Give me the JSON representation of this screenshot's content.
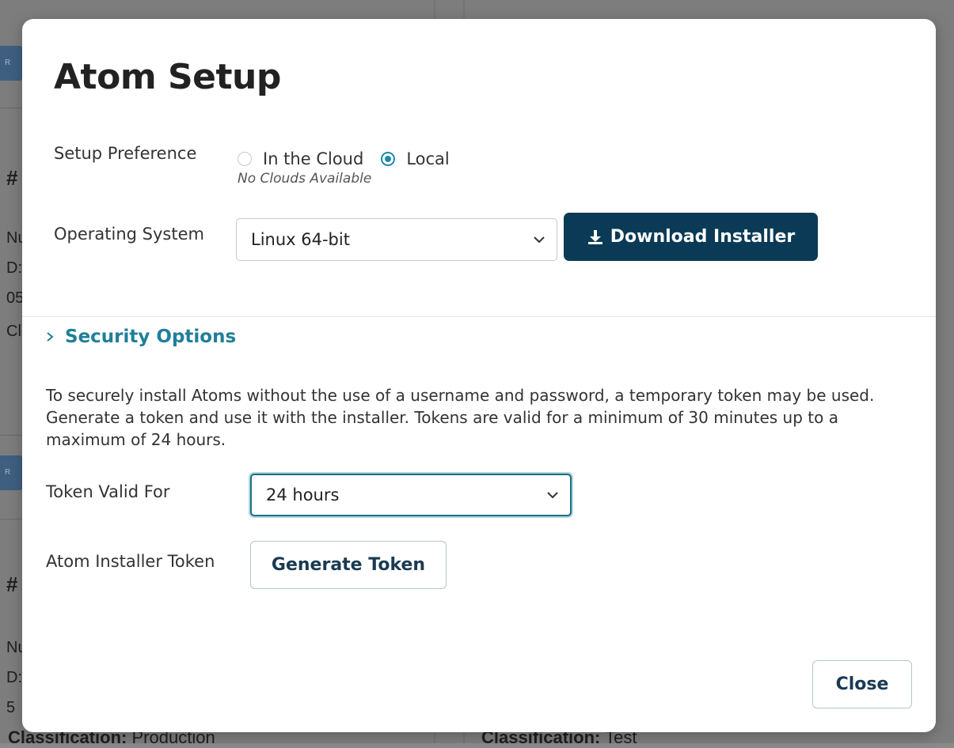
{
  "background": {
    "chip_text": "R",
    "glyphs": [
      "#",
      "#"
    ],
    "fragments": [
      "Nu",
      "D:",
      "05",
      "Cl",
      "Nu",
      "D:",
      "5"
    ],
    "left_classification": {
      "label": "Classification:",
      "value": "Production"
    },
    "right_classification": {
      "label": "Classification:",
      "value": "Test"
    }
  },
  "modal": {
    "title": "Atom Setup",
    "setup_preference": {
      "label": "Setup Preference",
      "options": [
        {
          "label": "In the Cloud",
          "checked": false
        },
        {
          "label": "Local",
          "checked": true
        }
      ],
      "hint": "No Clouds Available"
    },
    "operating_system": {
      "label": "Operating System",
      "selected": "Linux 64-bit"
    },
    "download_button": "Download Installer",
    "security_options": {
      "label": "Security Options",
      "expanded": true,
      "description": "To securely install Atoms without the use of a username and password, a temporary token may be used. Generate a token and use it with the installer. Tokens are valid for a minimum of 30 minutes up to a maximum of 24 hours.",
      "token_valid_for": {
        "label": "Token Valid For",
        "selected": "24 hours"
      },
      "installer_token": {
        "label": "Atom Installer Token",
        "button": "Generate Token"
      }
    },
    "close_button": "Close"
  },
  "colors": {
    "accent": "#1f8aa6",
    "primary_button": "#0b3a56",
    "section_link": "#1f7f98"
  },
  "icons": {
    "download": "download-icon",
    "section_toggle": "chevron-right-icon",
    "select_arrow": "chevron-down-icon"
  }
}
